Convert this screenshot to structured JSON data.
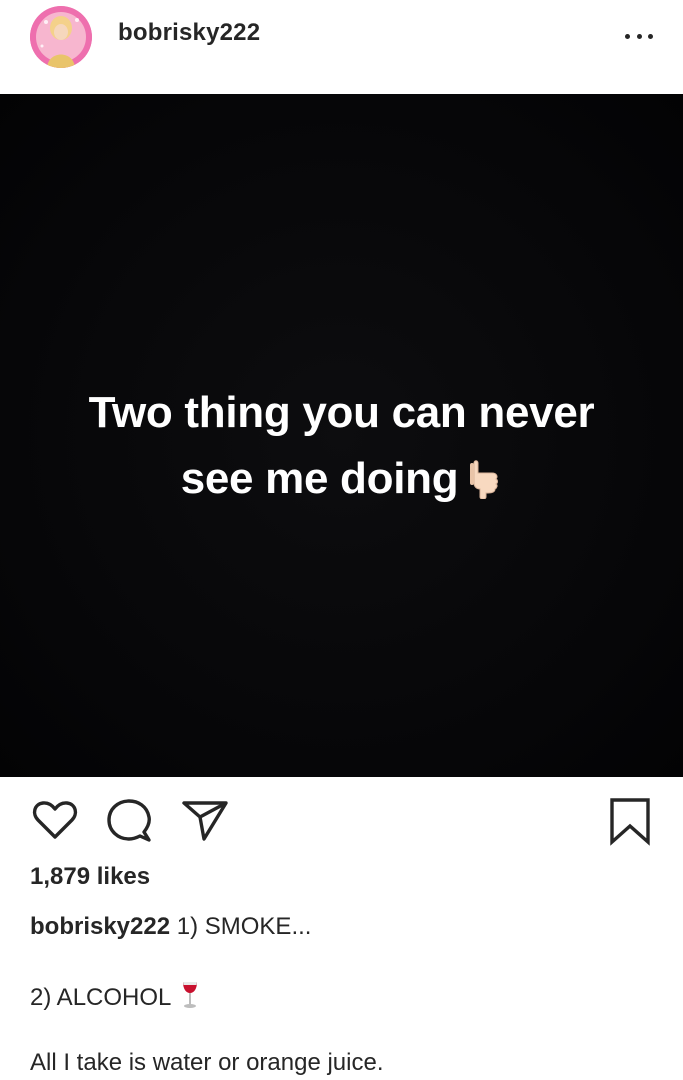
{
  "header": {
    "username": "bobrisky222"
  },
  "post": {
    "image_text_line1": "Two thing you can never",
    "image_text_line2": "see me doing",
    "image_icon": "pointing-down-hand-icon"
  },
  "actions": {
    "icons": [
      "heart-icon",
      "comment-icon",
      "share-icon",
      "bookmark-icon"
    ]
  },
  "likes": {
    "text": "1,879 likes"
  },
  "caption": {
    "username": "bobrisky222",
    "line1": "1) SMOKE...",
    "line2": "2) ALCOHOL",
    "line2_icon": "wine-glass-icon",
    "line3": "All I take is water or orange juice."
  },
  "colors": {
    "text": "#262626",
    "post_background": "#060608",
    "avatar_ring": "#e85ba0"
  }
}
